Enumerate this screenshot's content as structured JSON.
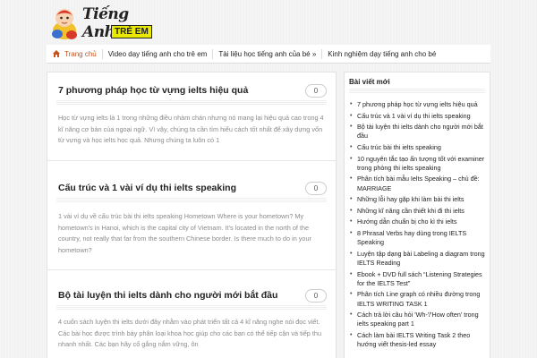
{
  "header": {
    "logo_line1": "Tiếng Anh",
    "logo_line2": "TRẺ EM"
  },
  "nav": {
    "items": [
      {
        "label": "Trang chủ",
        "icon": "home-icon",
        "active": true
      },
      {
        "label": "Video dạy tiếng anh cho trẻ em"
      },
      {
        "label": "Tài liệu học tiếng anh của bé »"
      },
      {
        "label": "Kinh nghiệm dạy tiếng anh cho bé"
      }
    ]
  },
  "posts": [
    {
      "title": "7 phương pháp học từ vựng ielts hiệu quả",
      "comments": "0",
      "excerpt": "Học từ vựng ielts là 1 trong những điều nhàm chán nhưng nó mang lại hiệu quả cao trong 4 kĩ năng cơ bản của ngoại ngữ. Vì vậy, chúng ta cần tìm hiểu cách tốt nhất để xây dựng vốn từ vựng và học ielts học quả. Nhưng chúng ta luôn có 1"
    },
    {
      "title": "Cấu trúc và 1 vài ví dụ thi ielts speaking",
      "comments": "0",
      "excerpt": "1 vài ví dụ về cấu trúc bài thi ielts speaking Hometown Where is your hometown? My hometown's in Hanoi, which is the capital city of Vietnam. It's located in the north of the country, not really that far from the southern Chinese border. Is there much to do in your hometown?"
    },
    {
      "title": "Bộ tài luyện thi ielts dành cho người mới bắt đầu",
      "comments": "0",
      "excerpt": "4 cuốn sách luyện thi ielts dưới đây nhằm vào phát triển tất cả 4 kĩ năng nghe nói đọc viết. Các bài học được trình bày phân loại khoa học giúp cho các bạn có thể tiếp cận và tiếp thu nhanh nhất. Các bạn hãy cố gắng nắm vững, ôn"
    }
  ],
  "sidebar": {
    "title": "Bài viết mới",
    "items": [
      "7 phương pháp học từ vựng ielts hiệu quả",
      "Cấu trúc và 1 vài ví dụ thi ielts speaking",
      "Bộ tài luyện thi ielts dành cho người mới bắt đầu",
      "Cấu trúc bài thi ielts speaking",
      "10 nguyên tắc tạo ấn tượng tốt với examiner trong phòng thi ielts speaking",
      "Phân tích bài mẫu Ielts Speaking – chủ đề: MARRIAGE",
      "Những lỗi hay gặp khi làm bài thi ielts",
      "Những kĩ năng cần thiết khi đi thi ielts",
      "Hướng dẫn chuẩn bị cho kì thi ielts",
      "8 Phrasal Verbs hay dùng trong IELTS Speaking",
      "Luyện tập dạng bài Labeling a diagram trong IELTS Reading",
      "Ebook + DVD full sách “Listening Strategies for the IELTS Test”",
      "Phân tích Line graph có nhiều đường trong IELTS WRITING TASK 1",
      "Cách trả lời câu hỏi 'Wh-'/'How often' trong ielts speaking part 1",
      "Cách làm bài IELTS Writing Task 2 theo hướng viết thesis-led essay"
    ]
  },
  "colors": {
    "accent": "#c8511b",
    "background": "#f4f4f4"
  }
}
